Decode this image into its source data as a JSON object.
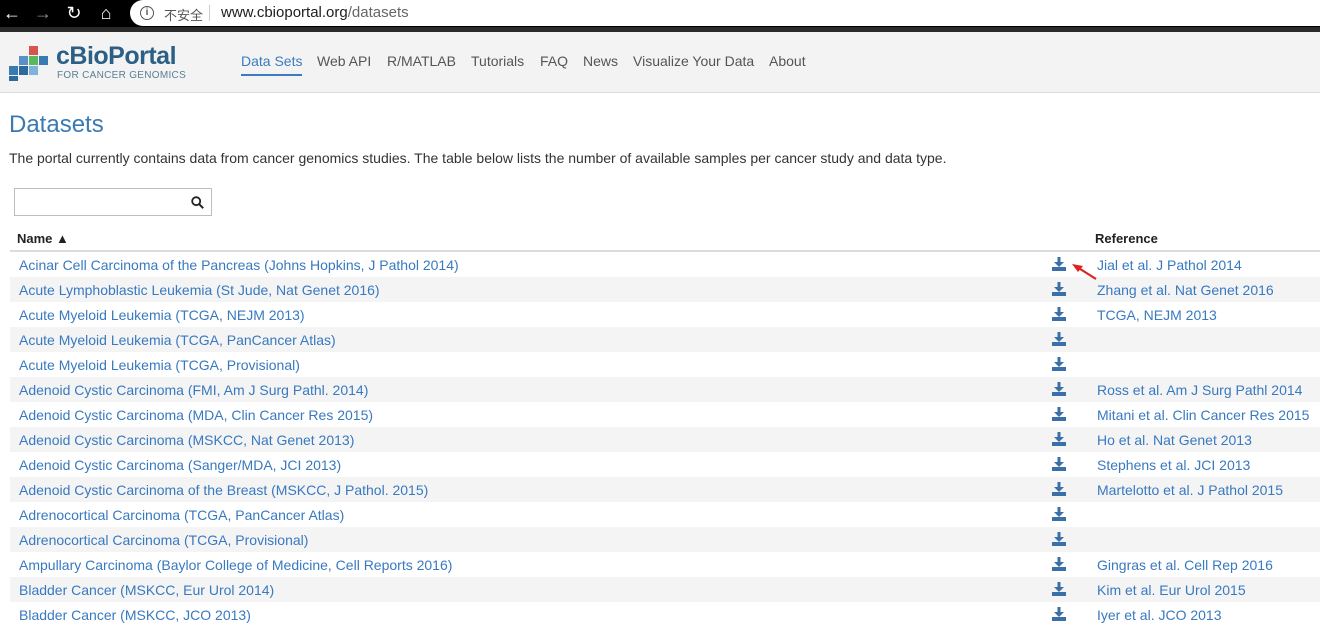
{
  "browser": {
    "security_label": "不安全",
    "url_host": "www.cbioportal.org",
    "url_path": "/datasets"
  },
  "brand": {
    "name": "cBioPortal",
    "tagline": "FOR CANCER GENOMICS"
  },
  "nav": {
    "items": [
      "Data Sets",
      "Web API",
      "R/MATLAB",
      "Tutorials",
      "FAQ",
      "News",
      "Visualize Your Data",
      "About"
    ],
    "active": "Data Sets"
  },
  "page": {
    "title": "Datasets",
    "intro": "The portal currently contains data from cancer genomics studies. The table below lists the number of available samples per cancer study and data type."
  },
  "search": {
    "placeholder": "",
    "value": ""
  },
  "table": {
    "columns": {
      "name": "Name ▲",
      "reference": "Reference"
    },
    "rows": [
      {
        "name": "Acinar Cell Carcinoma of the Pancreas (Johns Hopkins, J Pathol 2014)",
        "reference": "Jial et al. J Pathol 2014"
      },
      {
        "name": "Acute Lymphoblastic Leukemia (St Jude, Nat Genet 2016)",
        "reference": "Zhang et al. Nat Genet 2016"
      },
      {
        "name": "Acute Myeloid Leukemia (TCGA, NEJM 2013)",
        "reference": "TCGA, NEJM 2013"
      },
      {
        "name": "Acute Myeloid Leukemia (TCGA, PanCancer Atlas)",
        "reference": ""
      },
      {
        "name": "Acute Myeloid Leukemia (TCGA, Provisional)",
        "reference": ""
      },
      {
        "name": "Adenoid Cystic Carcinoma (FMI, Am J Surg Pathl. 2014)",
        "reference": "Ross et al. Am J Surg Pathl 2014"
      },
      {
        "name": "Adenoid Cystic Carcinoma (MDA, Clin Cancer Res 2015)",
        "reference": "Mitani et al. Clin Cancer Res 2015"
      },
      {
        "name": "Adenoid Cystic Carcinoma (MSKCC, Nat Genet 2013)",
        "reference": "Ho et al. Nat Genet 2013"
      },
      {
        "name": "Adenoid Cystic Carcinoma (Sanger/MDA, JCI 2013)",
        "reference": "Stephens et al. JCI 2013"
      },
      {
        "name": "Adenoid Cystic Carcinoma of the Breast (MSKCC, J Pathol. 2015)",
        "reference": "Martelotto et al. J Pathol 2015"
      },
      {
        "name": "Adrenocortical Carcinoma (TCGA, PanCancer Atlas)",
        "reference": ""
      },
      {
        "name": "Adrenocortical Carcinoma (TCGA, Provisional)",
        "reference": ""
      },
      {
        "name": "Ampullary Carcinoma (Baylor College of Medicine, Cell Reports 2016)",
        "reference": "Gingras et al. Cell Rep 2016"
      },
      {
        "name": "Bladder Cancer (MSKCC, Eur Urol 2014)",
        "reference": "Kim et al. Eur Urol 2015"
      },
      {
        "name": "Bladder Cancer (MSKCC, JCO 2013)",
        "reference": "Iyer et al. JCO 2013"
      }
    ]
  },
  "colors": {
    "link": "#3879c0",
    "title": "#3a7ab3",
    "download_icon": "#3a6fa8",
    "annotation_arrow": "#e02020"
  },
  "icons": {
    "download": "download-icon",
    "search": "search-icon",
    "annotation": "red-arrow-annotation"
  }
}
